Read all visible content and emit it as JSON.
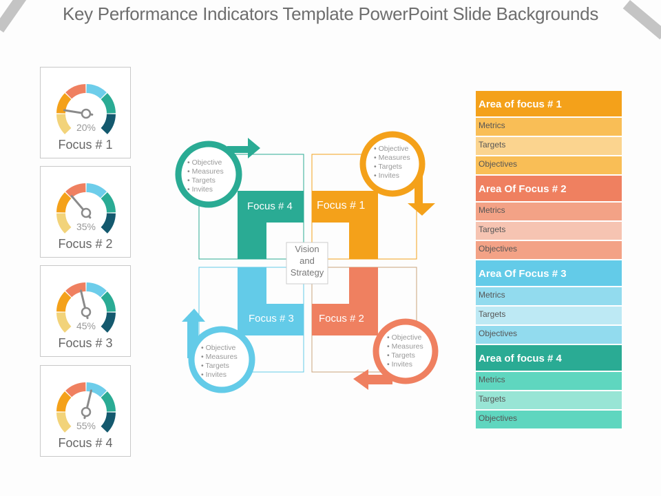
{
  "title": "Key Performance Indicators Template PowerPoint Slide Backgrounds",
  "colors": {
    "yellow": "#f2d37a",
    "orange": "#f4a11a",
    "coral": "#ef8060",
    "sky": "#6dcdea",
    "teal": "#2aab94",
    "navy": "#14596e",
    "needle": "#8a8a8a"
  },
  "gauges": [
    {
      "label": "Focus # 1",
      "percent_label": "20%",
      "value": 20
    },
    {
      "label": "Focus # 2",
      "percent_label": "35%",
      "value": 35
    },
    {
      "label": "Focus # 3",
      "percent_label": "45%",
      "value": 45
    },
    {
      "label": "Focus # 4",
      "percent_label": "55%",
      "value": 55
    }
  ],
  "quadrants": [
    {
      "label": "Focus # 4",
      "color": "#2aab94",
      "bullets": [
        "Objective",
        "Measures",
        "Targets",
        "Invites"
      ]
    },
    {
      "label": "Focus # 1",
      "color": "#f4a11a",
      "bullets": [
        "Objective",
        "Measures",
        "Targets",
        "Invites"
      ]
    },
    {
      "label": "Focus # 3",
      "color": "#63cbe8",
      "bullets": [
        "Objective",
        "Measures",
        "Targets",
        "Invites"
      ]
    },
    {
      "label": "Focus # 2",
      "color": "#ef8060",
      "bullets": [
        "Objective",
        "Measures",
        "Targets",
        "Invites"
      ]
    }
  ],
  "center": {
    "line1": "Vision",
    "line2": "and",
    "line3": "Strategy"
  },
  "areas": [
    {
      "title": "Area of focus # 1",
      "head": "#f4a11a",
      "row": "#f9be56",
      "alt": "#fbd48f",
      "rows": [
        "Metrics",
        "Targets",
        "Objectives"
      ]
    },
    {
      "title": "Area Of Focus # 2",
      "head": "#ef8060",
      "row": "#f3a286",
      "alt": "#f6c4b2",
      "rows": [
        "Metrics",
        "Targets",
        "Objectives"
      ]
    },
    {
      "title": "Area Of Focus # 3",
      "head": "#63cbe8",
      "row": "#92dbee",
      "alt": "#bde9f4",
      "rows": [
        "Metrics",
        "Targets",
        "Objectives"
      ]
    },
    {
      "title": "Area of focus # 4",
      "head": "#2aab94",
      "row": "#5fd6bf",
      "alt": "#98e5d5",
      "rows": [
        "Metrics",
        "Targets",
        "Objectives"
      ]
    }
  ]
}
